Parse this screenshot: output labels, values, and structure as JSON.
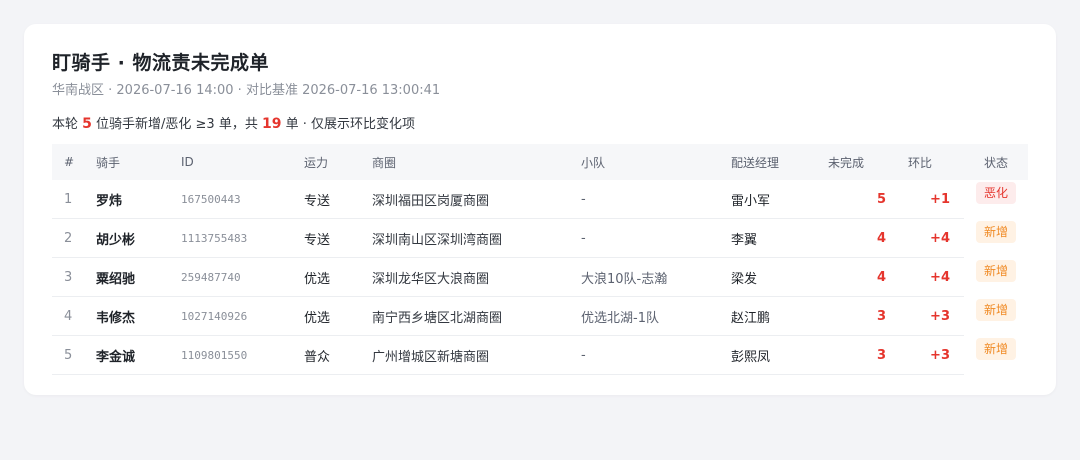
{
  "header": {
    "title": "盯骑手 · 物流责未完成单",
    "subtitle": "华南战区 · 2026-07-16 14:00 · 对比基准 2026-07-16 13:00:41"
  },
  "summary": {
    "prefix": "本轮 ",
    "rider_count": "5",
    "mid": " 位骑手新增/恶化 ≥3 单，共 ",
    "order_count": "19",
    "suffix": " 单 · 仅展示环比变化项"
  },
  "table": {
    "columns": [
      "#",
      "骑手",
      "ID",
      "运力",
      "商圈",
      "小队",
      "配送经理",
      "未完成",
      "环比",
      "状态"
    ],
    "rows": [
      {
        "idx": "1",
        "name": "罗炜",
        "id": "167500443",
        "capacity": "专送",
        "zone": "深圳福田区岗厦商圈",
        "team": "-",
        "manager": "雷小军",
        "undone": "5",
        "trend": "+1",
        "status": "恶化",
        "status_type": "worse"
      },
      {
        "idx": "2",
        "name": "胡少彬",
        "id": "1113755483",
        "capacity": "专送",
        "zone": "深圳南山区深圳湾商圈",
        "team": "-",
        "manager": "李翼",
        "undone": "4",
        "trend": "+4",
        "status": "新增",
        "status_type": "new"
      },
      {
        "idx": "3",
        "name": "粟绍驰",
        "id": "259487740",
        "capacity": "优选",
        "zone": "深圳龙华区大浪商圈",
        "team": "大浪10队-志瀚",
        "manager": "梁发",
        "undone": "4",
        "trend": "+4",
        "status": "新增",
        "status_type": "new"
      },
      {
        "idx": "4",
        "name": "韦修杰",
        "id": "1027140926",
        "capacity": "优选",
        "zone": "南宁西乡塘区北湖商圈",
        "team": "优选北湖-1队",
        "manager": "赵江鹏",
        "undone": "3",
        "trend": "+3",
        "status": "新增",
        "status_type": "new"
      },
      {
        "idx": "5",
        "name": "李金诚",
        "id": "1109801550",
        "capacity": "普众",
        "zone": "广州增城区新塘商圈",
        "team": "-",
        "manager": "彭熙凤",
        "undone": "3",
        "trend": "+3",
        "status": "新增",
        "status_type": "new"
      }
    ]
  },
  "colors": {
    "accent_red": "#e5352d",
    "new_orange": "#f08a24"
  }
}
